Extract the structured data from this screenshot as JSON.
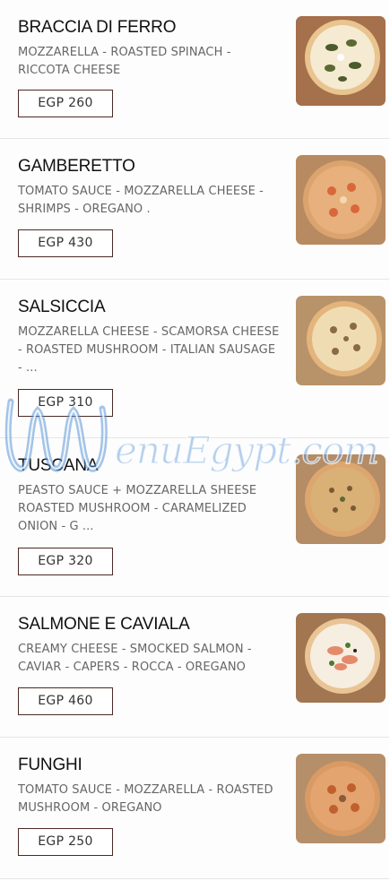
{
  "menu": {
    "items": [
      {
        "name": "BRACCIA DI FERRO",
        "description": "MOZZARELLA - ROASTED SPINACH - RICCOTA CHEESE",
        "price": "EGP 260",
        "image": "pizza-spinach-image"
      },
      {
        "name": "GAMBERETTO",
        "description": "TOMATO SAUCE - MOZZARELLA CHEESE - SHRIMPS - OREGANO .",
        "price": "EGP 430",
        "image": "pizza-shrimp-image"
      },
      {
        "name": "SALSICCIA",
        "description": "MOZZARELLA CHEESE - SCAMORSA CHEESE - ROASTED MUSHROOM - ITALIAN SAUSAGE - ...",
        "price": "EGP 310",
        "image": "pizza-sausage-image"
      },
      {
        "name": "TUSCANA",
        "description": "PEASTO SAUCE + MOZZARELLA SHEESE ROASTED MUSHROOM - CARAMELIZED ONION - G ...",
        "price": "EGP 320",
        "image": "pizza-pesto-image"
      },
      {
        "name": "SALMONE E CAVIALA",
        "description": "CREAMY CHEESE - SMOCKED SALMON - CAVIAR - CAPERS - ROCCA - OREGANO",
        "price": "EGP 460",
        "image": "pizza-salmon-image"
      },
      {
        "name": "FUNGHI",
        "description": "TOMATO SAUCE - MOZZARELLA - ROASTED MUSHROOM - OREGANO",
        "price": "EGP 250",
        "image": "pizza-mushroom-image"
      }
    ]
  },
  "watermark": {
    "text": "enuEgypt.com",
    "icon": "menu-egypt-logo-icon"
  },
  "colors": {
    "border": "#4a2a24",
    "text": "#111111",
    "muted": "#666666",
    "divider": "#e6e6e6",
    "watermark": "#5a96d7"
  }
}
